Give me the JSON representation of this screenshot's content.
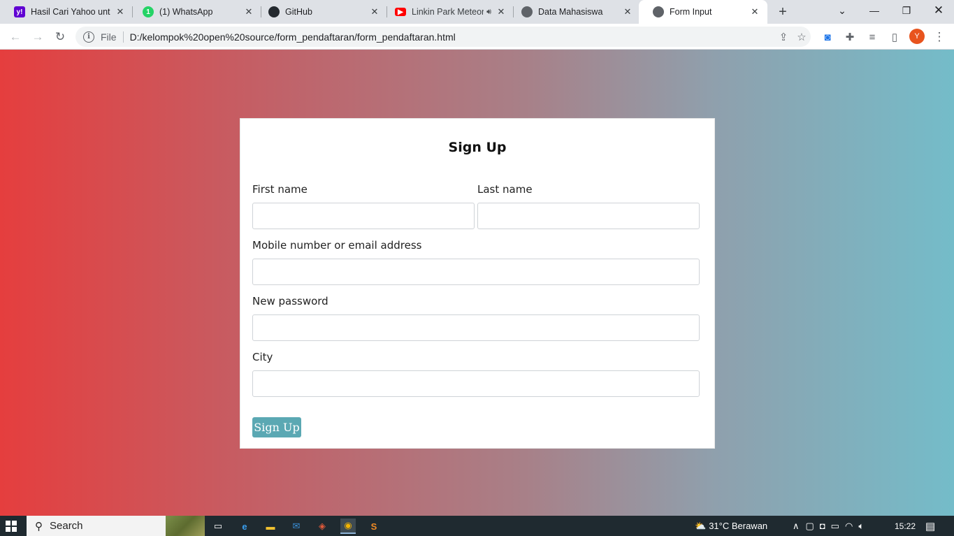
{
  "browser": {
    "tabs": [
      {
        "title": "Hasil Cari Yahoo untuk",
        "favicon": "yahoo-icon",
        "color": "#6001d2"
      },
      {
        "title": "(1) WhatsApp",
        "favicon": "whatsapp-icon",
        "color": "#25d366"
      },
      {
        "title": "GitHub",
        "favicon": "github-icon",
        "color": "#24292f"
      },
      {
        "title": "Linkin Park Meteora",
        "favicon": "youtube-icon",
        "color": "#ff0000"
      },
      {
        "title": "Data Mahasiswa",
        "favicon": "globe-icon",
        "color": "#5f6368"
      },
      {
        "title": "Form Input",
        "favicon": "globe-icon",
        "color": "#5f6368"
      }
    ],
    "scheme_label": "File",
    "url": "D:/kelompok%20open%20source/form_pendaftaran/form_pendaftaran.html",
    "avatar_letter": "Y"
  },
  "form": {
    "title": "Sign Up",
    "first_name_label": "First name",
    "last_name_label": "Last name",
    "contact_label": "Mobile number or email address",
    "password_label": "New password",
    "city_label": "City",
    "submit_label": "Sign Up"
  },
  "taskbar": {
    "search_label": "Search",
    "weather": "31°C  Berawan",
    "time": "15:22"
  }
}
